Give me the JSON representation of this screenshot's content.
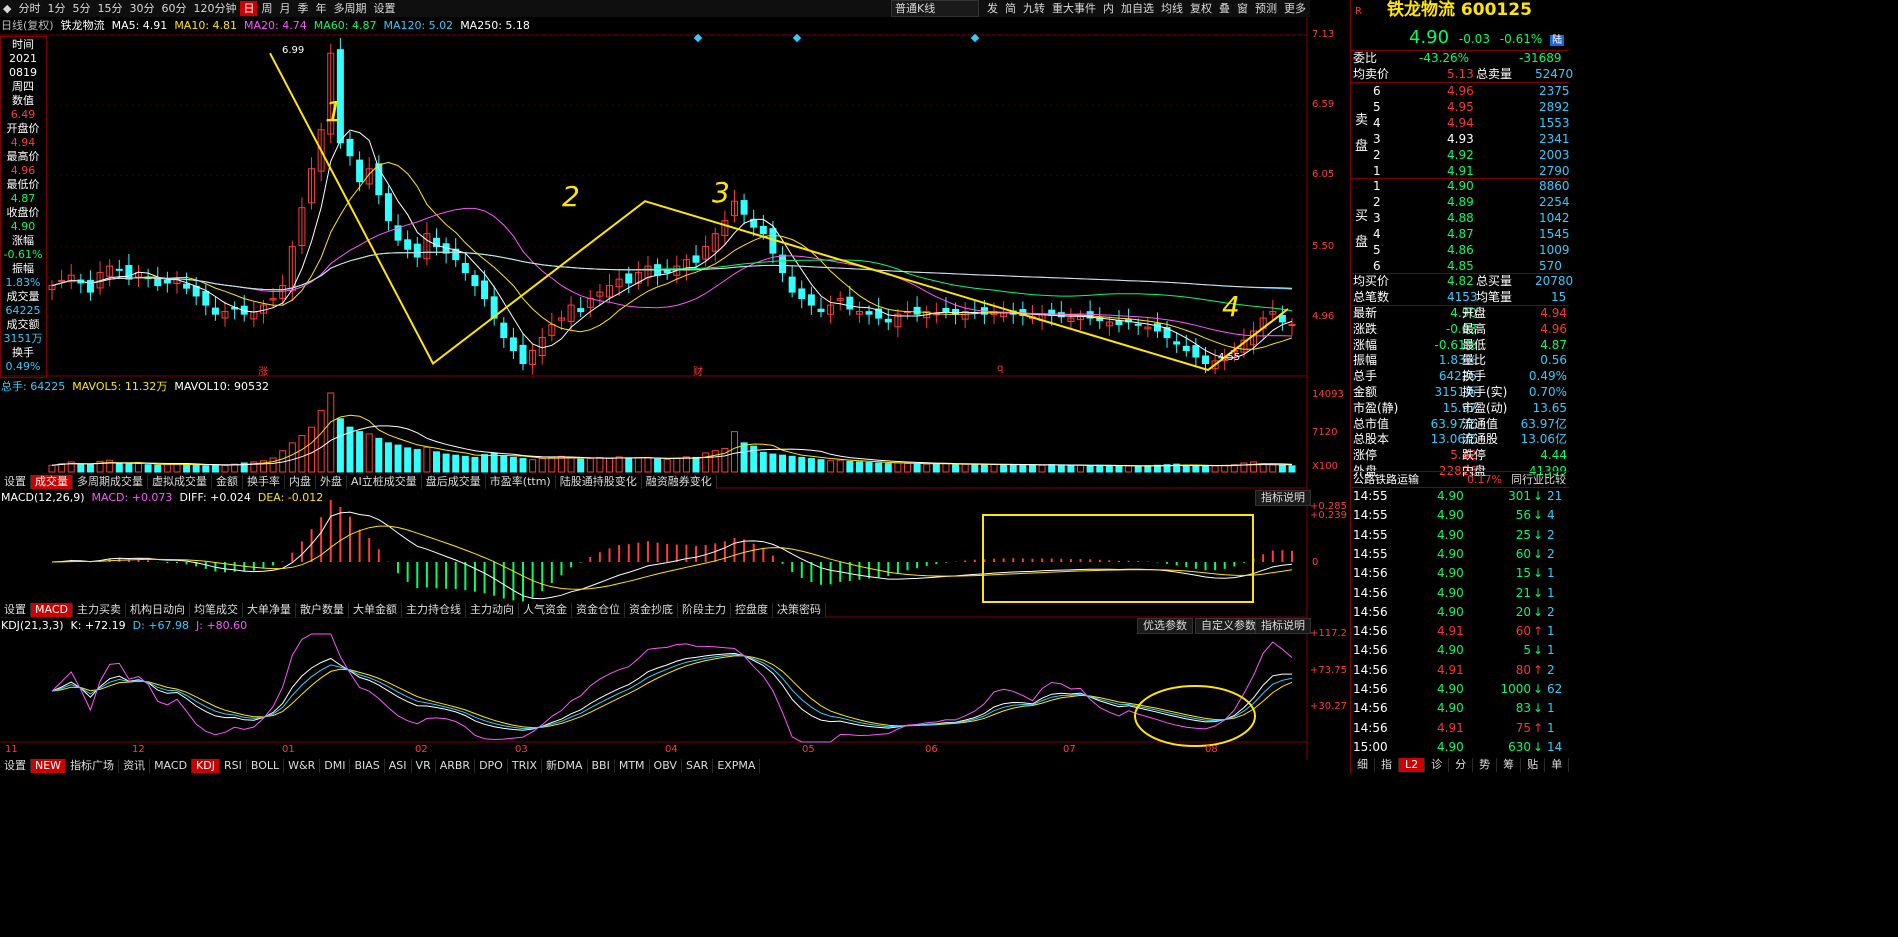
{
  "toolbar": {
    "periods": [
      "分时",
      "1分",
      "5分",
      "15分",
      "30分",
      "60分",
      "120分钟",
      "日",
      "周",
      "月",
      "季",
      "年",
      "多周期",
      "设置"
    ],
    "active_period": "日",
    "ktype": "普通K线",
    "right_items": [
      "发",
      "简",
      "九转",
      "重大事件",
      "内",
      "加自选",
      "均线",
      "复权",
      "叠",
      "窗",
      "预测",
      "更多"
    ]
  },
  "main_legend": {
    "label": "日线(复权)",
    "stock": "铁龙物流",
    "ma5": "MA5: 4.91",
    "ma10": "MA10: 4.81",
    "ma20": "MA20: 4.74",
    "ma60": "MA60: 4.87",
    "ma120": "MA120: 5.02",
    "ma250": "MA250: 5.18"
  },
  "info_panel": {
    "items": [
      {
        "label": "时间",
        "value": "2021"
      },
      {
        "label": "",
        "value": "0819"
      },
      {
        "label": "",
        "value": "周四"
      },
      {
        "label": "数值",
        "value": "6.49"
      },
      {
        "label": "开盘价",
        "value": "4.94"
      },
      {
        "label": "最高价",
        "value": "4.96"
      },
      {
        "label": "最低价",
        "value": "4.87"
      },
      {
        "label": "收盘价",
        "value": "4.90"
      },
      {
        "label": "涨幅",
        "value": "-0.61%"
      },
      {
        "label": "振幅",
        "value": "1.83%"
      },
      {
        "label": "成交量",
        "value": "64225"
      },
      {
        "label": "成交额",
        "value": "3151万"
      },
      {
        "label": "换手",
        "value": "0.49%"
      }
    ]
  },
  "annotations": {
    "wave1": "1",
    "wave2": "2",
    "wave3": "3",
    "wave4": "4",
    "high_label": "6.99",
    "low_label": "4.55",
    "marker_zhang": "涨",
    "marker_cai": "财",
    "marker_q": "q"
  },
  "vol_legend": {
    "total": "总手: 64225",
    "mavol5": "MAVOL5: 11.32万",
    "mavol10": "MAVOL10: 90532"
  },
  "vol_axis": [
    "14093",
    "7120",
    "X100"
  ],
  "vol_tabs": [
    "设置",
    "成交量",
    "多周期成交量",
    "虚拟成交量",
    "金额",
    "换手率",
    "内盘",
    "外盘",
    "AI立桩成交量",
    "盘后成交量",
    "市盈率(ttm)",
    "陆股通持股变化",
    "融资融券变化"
  ],
  "vol_active": "成交量",
  "macd_legend": {
    "name": "MACD(12,26,9)",
    "macd": "MACD: +0.073",
    "diff": "DIFF: +0.024",
    "dea": "DEA: -0.012"
  },
  "macd_axis": [
    "+0.285",
    "+0.239",
    "0"
  ],
  "macd_help": "指标说明",
  "macd_tabs": [
    "设置",
    "MACD",
    "主力买卖",
    "机构日动向",
    "均笔成交",
    "大单净量",
    "散户数量",
    "大单金额",
    "主力持仓线",
    "主力动向",
    "人气资金",
    "资金仓位",
    "资金抄底",
    "阶段主力",
    "控盘度",
    "决策密码"
  ],
  "macd_active": "MACD",
  "kdj_legend": {
    "name": "KDJ(21,3,3)",
    "k": "K: +72.19",
    "d": "D: +67.98",
    "j": "J: +80.60"
  },
  "kdj_axis": [
    "+117.2",
    "+73.75",
    "+30.27"
  ],
  "kdj_buttons": [
    "优选参数",
    "自定义参数",
    "指标说明"
  ],
  "x_axis": [
    "11",
    "12",
    "01",
    "02",
    "03",
    "04",
    "05",
    "06",
    "07",
    "08"
  ],
  "bottom_tabs": [
    "设置",
    "NEW",
    "指标广场",
    "资讯",
    "MACD",
    "KDJ",
    "RSI",
    "BOLL",
    "W&R",
    "DMI",
    "BIAS",
    "ASI",
    "VR",
    "ARBR",
    "DPO",
    "TRIX",
    "新DMA",
    "BBI",
    "MTM",
    "OBV",
    "SAR",
    "EXPMA"
  ],
  "bottom_active": "KDJ",
  "price_axis": [
    "7.13",
    "6.59",
    "6.05",
    "5.50",
    "4.96"
  ],
  "right_panel": {
    "name": "铁龙物流",
    "code": "600125",
    "price": "4.90",
    "change": "-0.03",
    "pct": "-0.61%",
    "tag": "陆",
    "weibi_label": "委比",
    "weibi_pct": "-43.26%",
    "weibi_val": "-31689",
    "jmj_label": "均卖价",
    "jmj": "5.13",
    "zml_label": "总卖量",
    "zml": "52470",
    "sell_side": "卖盘",
    "asks": [
      {
        "lv": "6",
        "p": "4.96",
        "v": "2375"
      },
      {
        "lv": "5",
        "p": "4.95",
        "v": "2892"
      },
      {
        "lv": "4",
        "p": "4.94",
        "v": "1553"
      },
      {
        "lv": "3",
        "p": "4.93",
        "v": "2341"
      },
      {
        "lv": "2",
        "p": "4.92",
        "v": "2003"
      },
      {
        "lv": "1",
        "p": "4.91",
        "v": "2790"
      }
    ],
    "buy_side": "买盘",
    "bids": [
      {
        "lv": "1",
        "p": "4.90",
        "v": "8860"
      },
      {
        "lv": "2",
        "p": "4.89",
        "v": "2254"
      },
      {
        "lv": "3",
        "p": "4.88",
        "v": "1042"
      },
      {
        "lv": "4",
        "p": "4.87",
        "v": "1545"
      },
      {
        "lv": "5",
        "p": "4.86",
        "v": "1009"
      },
      {
        "lv": "6",
        "p": "4.85",
        "v": "570"
      }
    ],
    "jmj2_label": "均买价",
    "jmj2": "4.82",
    "zml2_label": "总买量",
    "zml2": "20780",
    "zbs_label": "总笔数",
    "zbs": "4153",
    "jbl_label": "均笔量",
    "jbl": "15",
    "stats": [
      {
        "l1": "最新",
        "v1": "4.90",
        "l2": "开盘",
        "v2": "4.94"
      },
      {
        "l1": "涨跌",
        "v1": "-0.03",
        "l2": "最高",
        "v2": "4.96"
      },
      {
        "l1": "涨幅",
        "v1": "-0.61%",
        "l2": "最低",
        "v2": "4.87"
      },
      {
        "l1": "振幅",
        "v1": "1.83%",
        "l2": "量比",
        "v2": "0.56"
      },
      {
        "l1": "总手",
        "v1": "64225",
        "l2": "换手",
        "v2": "0.49%"
      },
      {
        "l1": "金额",
        "v1": "3151万",
        "l2": "换手(实)",
        "v2": "0.70%"
      },
      {
        "l1": "市盈(静)",
        "v1": "15.97",
        "l2": "市盈(动)",
        "v2": "13.65"
      },
      {
        "l1": "总市值",
        "v1": "63.97亿",
        "l2": "流通值",
        "v2": "63.97亿"
      },
      {
        "l1": "总股本",
        "v1": "13.06亿",
        "l2": "流通股",
        "v2": "13.06亿"
      },
      {
        "l1": "涨停",
        "v1": "5.42",
        "l2": "跌停",
        "v2": "4.44"
      },
      {
        "l1": "外盘",
        "v1": "22826",
        "l2": "内盘",
        "v2": "41399"
      }
    ],
    "industry": "公路铁路运输",
    "industry_pct": "0.17%",
    "industry_btn": "同行业比较",
    "ticks": [
      {
        "t": "14:55",
        "p": "4.90",
        "v": "301",
        "n": "21"
      },
      {
        "t": "14:55",
        "p": "4.90",
        "v": "56",
        "n": "4"
      },
      {
        "t": "14:55",
        "p": "4.90",
        "v": "25",
        "n": "2"
      },
      {
        "t": "14:55",
        "p": "4.90",
        "v": "60",
        "n": "2"
      },
      {
        "t": "14:56",
        "p": "4.90",
        "v": "15",
        "n": "1"
      },
      {
        "t": "14:56",
        "p": "4.90",
        "v": "21",
        "n": "1"
      },
      {
        "t": "14:56",
        "p": "4.90",
        "v": "20",
        "n": "2"
      },
      {
        "t": "14:56",
        "p": "4.91",
        "v": "60",
        "n": "1"
      },
      {
        "t": "14:56",
        "p": "4.90",
        "v": "5",
        "n": "1"
      },
      {
        "t": "14:56",
        "p": "4.91",
        "v": "80",
        "n": "2"
      },
      {
        "t": "14:56",
        "p": "4.90",
        "v": "1000",
        "n": "62"
      },
      {
        "t": "14:56",
        "p": "4.90",
        "v": "83",
        "n": "1"
      },
      {
        "t": "14:56",
        "p": "4.91",
        "v": "75",
        "n": "1"
      },
      {
        "t": "15:00",
        "p": "4.90",
        "v": "630",
        "n": "14"
      }
    ],
    "bottom_tabs": [
      "细",
      "指",
      "L2",
      "诊",
      "分",
      "势",
      "筹",
      "贴",
      "单"
    ]
  },
  "chart_data": {
    "type": "candlestick",
    "title": "铁龙物流 600125 日线",
    "x_months": [
      "11",
      "12",
      "01",
      "02",
      "03",
      "04",
      "05",
      "06",
      "07",
      "08"
    ],
    "ylim": [
      4.55,
      7.13
    ],
    "close": [
      5.2,
      5.24,
      5.28,
      5.22,
      5.15,
      5.3,
      5.35,
      5.32,
      5.25,
      5.3,
      5.26,
      5.2,
      5.22,
      5.25,
      5.18,
      5.12,
      5.05,
      4.98,
      5.0,
      5.02,
      4.98,
      5.0,
      5.05,
      5.1,
      5.2,
      5.5,
      5.8,
      6.1,
      6.4,
      6.99,
      6.3,
      6.2,
      6.0,
      6.1,
      5.9,
      5.7,
      5.55,
      5.48,
      5.42,
      5.6,
      5.5,
      5.45,
      5.4,
      5.3,
      5.2,
      5.1,
      4.95,
      4.8,
      4.7,
      4.6,
      4.7,
      4.8,
      4.9,
      4.95,
      5.05,
      5.0,
      5.1,
      5.15,
      5.2,
      5.25,
      5.22,
      5.3,
      5.35,
      5.28,
      5.3,
      5.35,
      5.4,
      5.38,
      5.5,
      5.6,
      5.7,
      5.85,
      5.75,
      5.65,
      5.6,
      5.45,
      5.3,
      5.15,
      5.1,
      5.05,
      5.0,
      5.05,
      5.1,
      5.02,
      5.0,
      4.98,
      4.95,
      4.92,
      4.98,
      5.0,
      4.98,
      5.0,
      4.99,
      5.0,
      4.98,
      5.0,
      4.99,
      4.98,
      5.0,
      4.99,
      4.98,
      4.97,
      4.96,
      4.98,
      4.97,
      4.96,
      4.95,
      4.96,
      4.95,
      4.93,
      4.92,
      4.9,
      4.92,
      4.9,
      4.88,
      4.85,
      4.8,
      4.75,
      4.7,
      4.65,
      4.6,
      4.62,
      4.65,
      4.7,
      4.78,
      4.85,
      4.95,
      5.0,
      4.92,
      4.9
    ],
    "volume": [
      1200,
      1500,
      1800,
      1400,
      1300,
      1900,
      2100,
      1600,
      1400,
      1500,
      1300,
      1200,
      1400,
      1500,
      1300,
      1200,
      1100,
      1300,
      1200,
      1400,
      1600,
      1800,
      2000,
      2500,
      3800,
      5200,
      6500,
      8000,
      11000,
      14093,
      9500,
      8000,
      7200,
      6800,
      6000,
      5200,
      4800,
      4300,
      4000,
      4400,
      3600,
      3200,
      3000,
      2800,
      2600,
      3100,
      3300,
      2900,
      2600,
      2400,
      2200,
      2400,
      2600,
      2800,
      2500,
      2300,
      2400,
      2600,
      2500,
      2700,
      2400,
      2500,
      2600,
      2300,
      2200,
      2500,
      2700,
      2600,
      3400,
      3800,
      4200,
      7200,
      5200,
      4600,
      3500,
      3200,
      3000,
      2800,
      2600,
      2400,
      2200,
      2000,
      2100,
      1900,
      1800,
      1700,
      1600,
      1500,
      1600,
      1500,
      1500,
      1400,
      1400,
      1500,
      1300,
      1400,
      1300,
      1300,
      1400,
      1300,
      1200,
      1300,
      1200,
      1200,
      1300,
      1200,
      1100,
      1200,
      1100,
      1200,
      1100,
      1000,
      1100,
      1000,
      1100,
      1200,
      1300,
      1400,
      1200,
      1100,
      1000,
      1100,
      1200,
      1300,
      1600,
      1800,
      1500,
      1300,
      1200,
      1100
    ],
    "wave_points": [
      {
        "label": "1",
        "from": 6.99,
        "to": 4.6
      },
      {
        "label": "2",
        "from": 4.6,
        "to": 5.85
      },
      {
        "label": "3",
        "from": 5.85,
        "to": 4.55
      },
      {
        "label": "4",
        "from": 4.55,
        "to": 5.0
      }
    ],
    "macd_range": [
      -0.3,
      0.285
    ],
    "kdj_range": [
      -10,
      117.2
    ]
  }
}
